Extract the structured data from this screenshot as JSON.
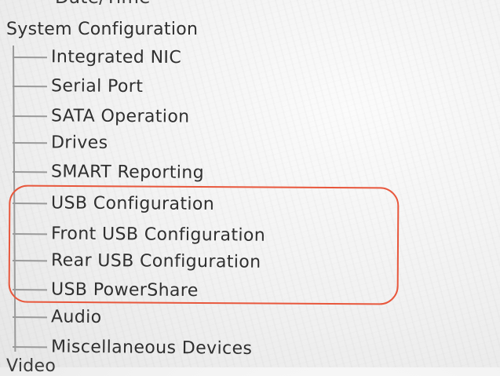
{
  "tree": {
    "partial_top_item": "Date/Time",
    "group": {
      "label": "System Configuration",
      "items": [
        {
          "label": "Integrated NIC"
        },
        {
          "label": "Serial Port"
        },
        {
          "label": "SATA Operation"
        },
        {
          "label": "Drives"
        },
        {
          "label": "SMART Reporting"
        },
        {
          "label": "USB Configuration"
        },
        {
          "label": "Front USB Configuration"
        },
        {
          "label": "Rear USB Configuration"
        },
        {
          "label": "USB PowerShare"
        },
        {
          "label": "Audio"
        },
        {
          "label": "Miscellaneous Devices"
        }
      ]
    },
    "partial_bottom_item": "Video"
  },
  "annotation": {
    "highlight_color": "#e8573c"
  }
}
